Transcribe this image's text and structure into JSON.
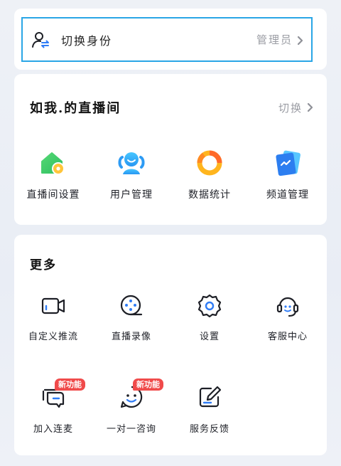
{
  "identity": {
    "label": "切换身份",
    "value": "管理员",
    "icon": "user-switch-icon"
  },
  "live_room": {
    "title": "如我.的直播间",
    "switch_label": "切换",
    "items": [
      {
        "label": "直播间设置",
        "icon": "room-settings-icon"
      },
      {
        "label": "用户管理",
        "icon": "user-management-icon"
      },
      {
        "label": "数据统计",
        "icon": "data-stats-icon"
      },
      {
        "label": "频道管理",
        "icon": "channel-management-icon"
      }
    ]
  },
  "more": {
    "title": "更多",
    "items": [
      {
        "label": "自定义推流",
        "icon": "video-camera-icon"
      },
      {
        "label": "直播录像",
        "icon": "film-reel-icon"
      },
      {
        "label": "设置",
        "icon": "gear-icon"
      },
      {
        "label": "客服中心",
        "icon": "headset-icon"
      },
      {
        "label": "加入连麦",
        "icon": "chat-bubbles-icon",
        "badge": "新功能"
      },
      {
        "label": "一对一咨询",
        "icon": "chat-smile-icon",
        "badge": "新功能"
      },
      {
        "label": "服务反馈",
        "icon": "feedback-edit-icon"
      }
    ]
  },
  "colors": {
    "accent_blue": "#2f7cf6",
    "badge_red": "#f04a4a",
    "selection_border": "#2aa6e6"
  }
}
